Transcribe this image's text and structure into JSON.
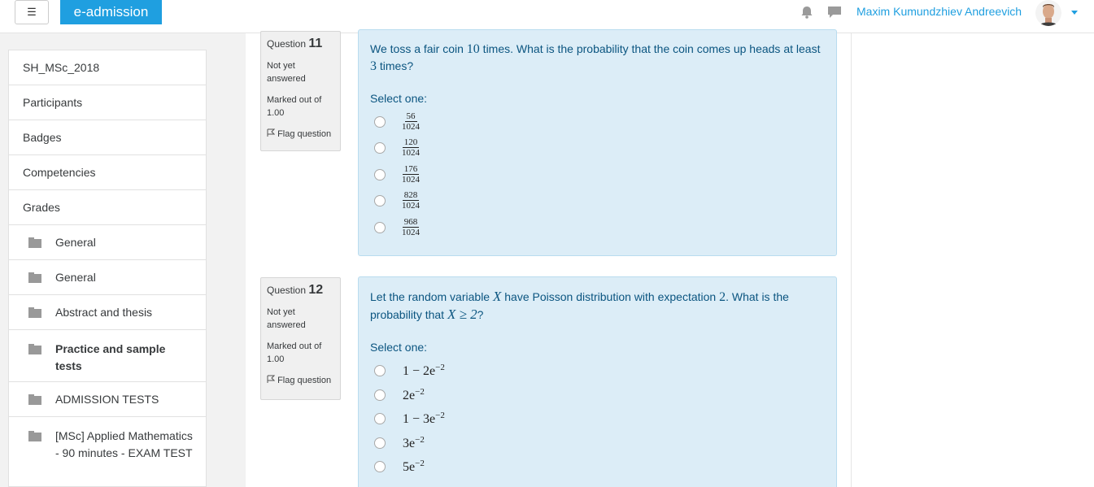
{
  "navbar": {
    "brand": "e-admission",
    "user_name": "Maxim Kumundzhiev Andreevich"
  },
  "sidebar": {
    "items": [
      {
        "label": "SH_MSc_2018",
        "folder": false
      },
      {
        "label": "Participants",
        "folder": false
      },
      {
        "label": "Badges",
        "folder": false
      },
      {
        "label": "Competencies",
        "folder": false
      },
      {
        "label": "Grades",
        "folder": false
      },
      {
        "label": "General",
        "folder": true
      },
      {
        "label": "General",
        "folder": true
      },
      {
        "label": "Abstract and thesis",
        "folder": true
      },
      {
        "label": "Practice and sample tests",
        "folder": true,
        "bold": true
      },
      {
        "label": "ADMISSION TESTS",
        "folder": true
      },
      {
        "label": "[MSc] Applied Mathematics - 90 minutes - EXAM TEST",
        "folder": true
      }
    ]
  },
  "questions": [
    {
      "label": "Question",
      "number": "11",
      "status": "Not yet answered",
      "marked": "Marked out of 1.00",
      "flag": "Flag question",
      "text_a": "We toss a fair coin ",
      "text_m1": "10",
      "text_b": " times. What is the probability that the coin comes up heads at least ",
      "text_m2": "3",
      "text_c": " times?",
      "select_label": "Select one:",
      "options": [
        {
          "num": "56",
          "den": "1024"
        },
        {
          "num": "120",
          "den": "1024"
        },
        {
          "num": "176",
          "den": "1024"
        },
        {
          "num": "828",
          "den": "1024"
        },
        {
          "num": "968",
          "den": "1024"
        }
      ]
    },
    {
      "label": "Question",
      "number": "12",
      "status": "Not yet answered",
      "marked": "Marked out of 1.00",
      "flag": "Flag question",
      "text_a": "Let the random variable ",
      "text_m1": "X",
      "text_b": " have Poisson distribution with expectation ",
      "text_m2": "2",
      "text_c": ". What is the probability that ",
      "text_m3": "X ≥ 2",
      "text_d": "?",
      "select_label": "Select one:",
      "options": [
        {
          "base": "1 − 2e",
          "exp": "−2"
        },
        {
          "base": "2e",
          "exp": "−2"
        },
        {
          "base": "1 − 3e",
          "exp": "−2"
        },
        {
          "base": "3e",
          "exp": "−2"
        },
        {
          "base": "5e",
          "exp": "−2"
        }
      ]
    }
  ]
}
